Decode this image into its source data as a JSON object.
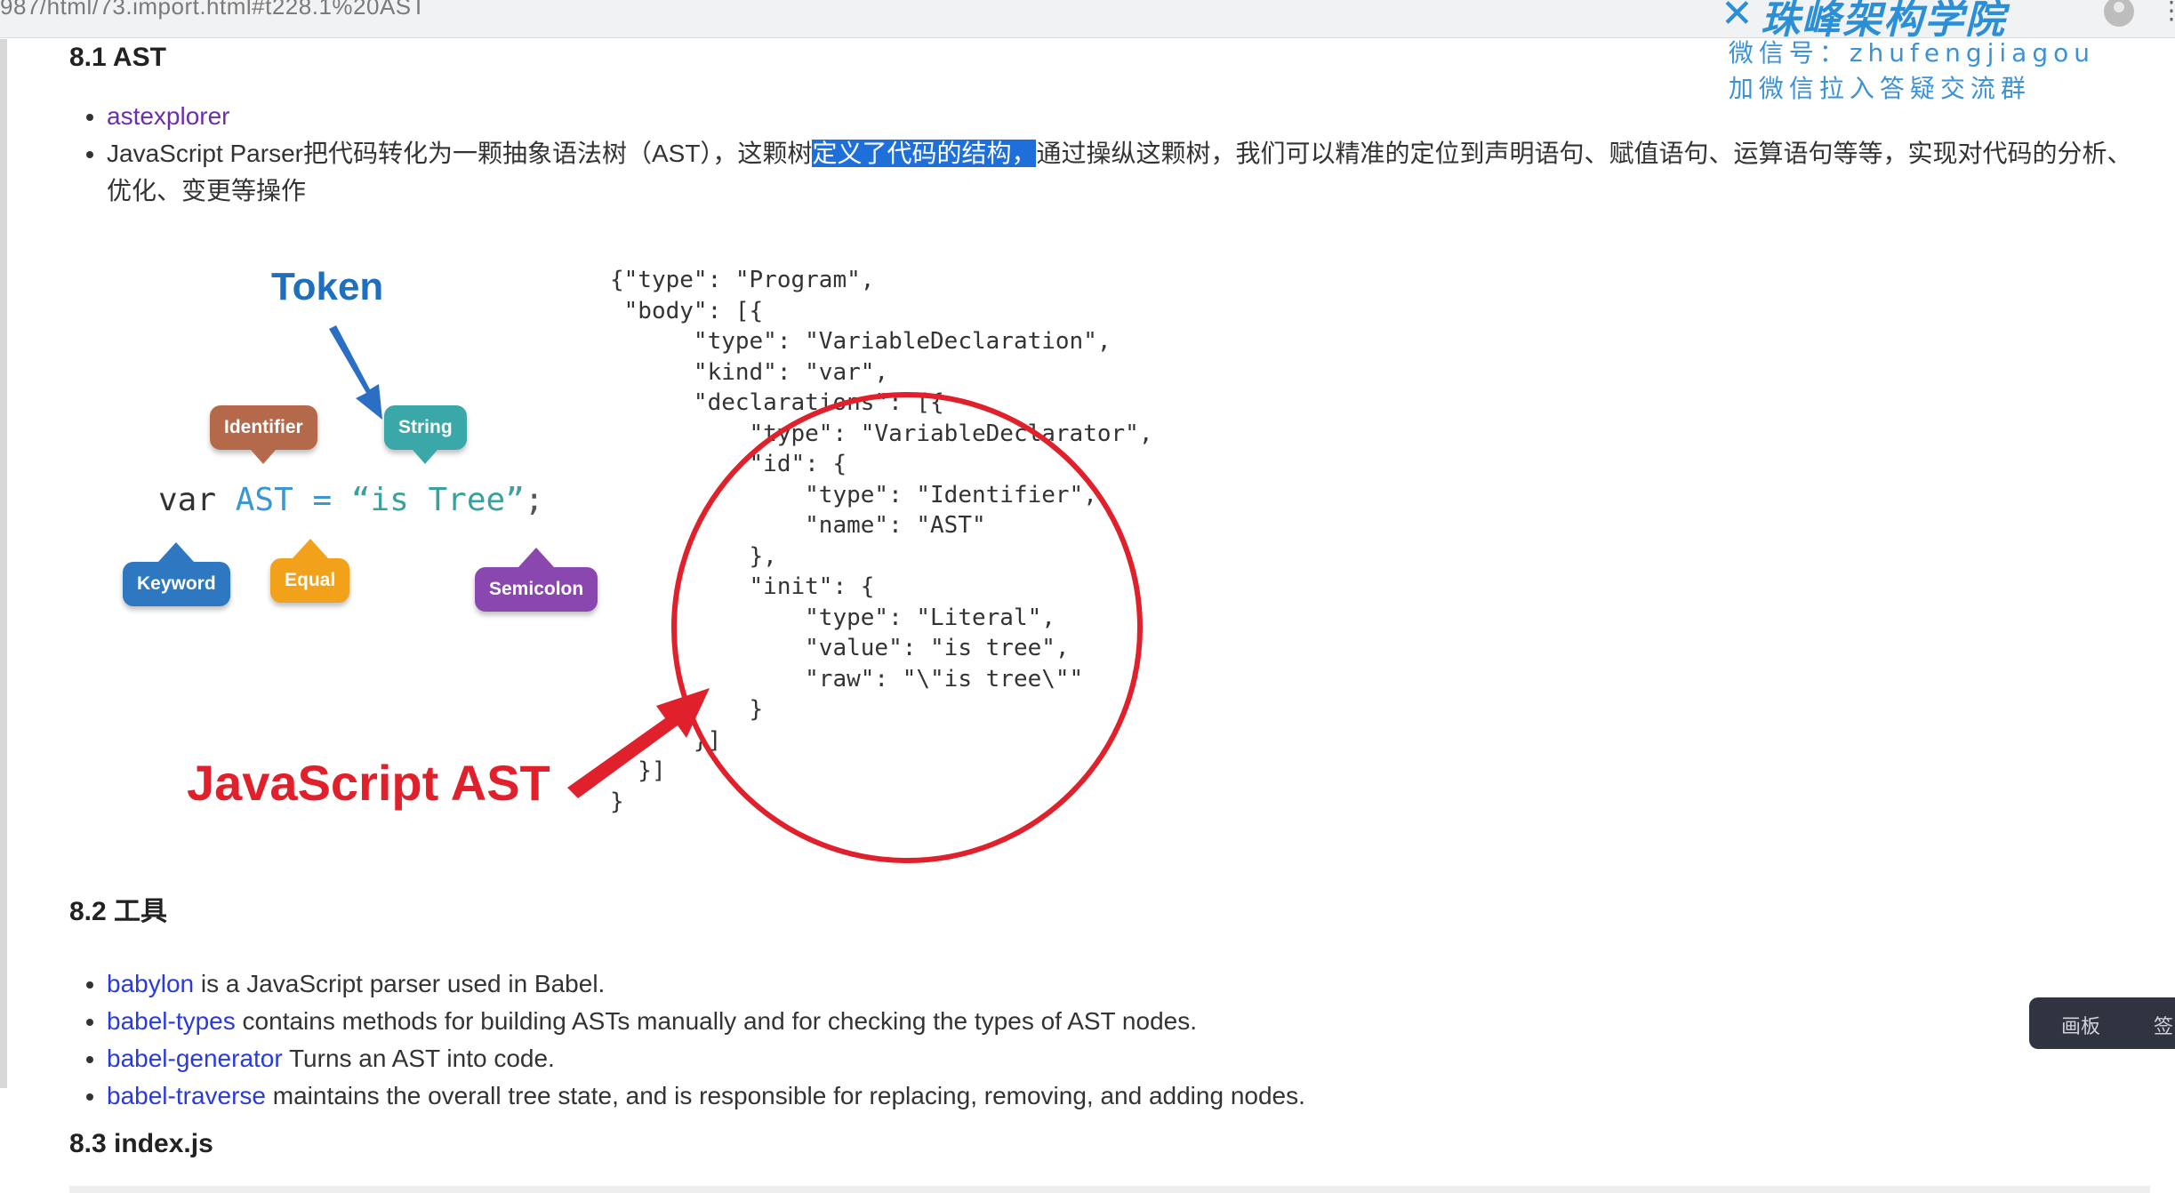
{
  "browser": {
    "url_fragment": "987/html/73.import.html#t228.1%20AST",
    "brand_name": "珠峰架构学院"
  },
  "watermark": {
    "line1": "微信号：zhufengjiagou",
    "line2": "加微信拉入答疑交流群"
  },
  "section_ast": {
    "heading": "8.1 AST",
    "link_astexplorer": "astexplorer",
    "para_before": "JavaScript Parser把代码转化为一颗抽象语法树（AST），这颗树",
    "para_selected": "定义了代码的结构，",
    "para_after": "通过操纵这颗树，我们可以精准的定位到声明语句、赋值语句、运算语句等等，实现对代码的分析、优化、变更等操作"
  },
  "figure": {
    "token_title": "Token",
    "statement_var": "var",
    "statement_id": "AST",
    "statement_eq": "=",
    "statement_str": "“is Tree”",
    "statement_semi": ";",
    "bubble_identifier": "Identifier",
    "bubble_string": "String",
    "bubble_keyword": "Keyword",
    "bubble_equal": "Equal",
    "bubble_semicolon": "Semicolon",
    "ast_title": "JavaScript AST",
    "code_lines": [
      "{\"type\": \"Program\",",
      " \"body\": [{",
      "      \"type\": \"VariableDeclaration\",",
      "      \"kind\": \"var\",",
      "      \"declarations\": [{",
      "          \"type\": \"VariableDeclarator\",",
      "          \"id\": {",
      "              \"type\": \"Identifier\",",
      "              \"name\": \"AST\"",
      "          },",
      "          \"init\": {",
      "              \"type\": \"Literal\",",
      "              \"value\": \"is tree\",",
      "              \"raw\": \"\\\"is tree\\\"\"",
      "          }",
      "      }]",
      "  }]",
      "}"
    ]
  },
  "section_tools": {
    "heading": "8.2 工具",
    "items": [
      {
        "link": "babylon",
        "text": " is a JavaScript parser used in Babel."
      },
      {
        "link": "babel-types",
        "text": " contains methods for building ASTs manually and for checking the types of AST nodes."
      },
      {
        "link": "babel-generator",
        "text": " Turns an AST into code."
      },
      {
        "link": "babel-traverse",
        "text": " maintains the overall tree state, and is responsible for replacing, removing, and adding nodes."
      }
    ]
  },
  "section_index": {
    "heading": "8.3 index.js"
  },
  "float_panel": {
    "label1": "画板",
    "label2": "签"
  }
}
